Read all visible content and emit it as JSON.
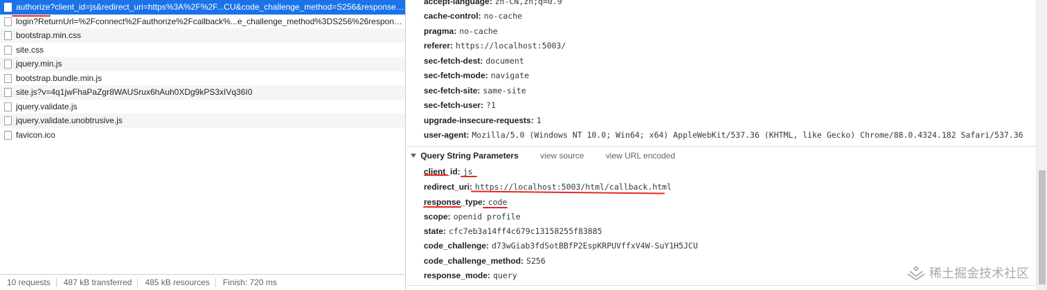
{
  "requests": [
    {
      "name": "authorize?client_id=js&redirect_uri=https%3A%2F%2F...CU&code_challenge_method=S256&response_m..."
    },
    {
      "name": "login?ReturnUrl=%2Fconnect%2Fauthorize%2Fcallback%...e_challenge_method%3DS256%26response_m..."
    },
    {
      "name": "bootstrap.min.css"
    },
    {
      "name": "site.css"
    },
    {
      "name": "jquery.min.js"
    },
    {
      "name": "bootstrap.bundle.min.js"
    },
    {
      "name": "site.js?v=4q1jwFhaPaZgr8WAUSrux6hAuh0XDg9kPS3xIVq36I0"
    },
    {
      "name": "jquery.validate.js"
    },
    {
      "name": "jquery.validate.unobtrusive.js"
    },
    {
      "name": "favicon.ico"
    }
  ],
  "status_bar": {
    "requests": "10 requests",
    "transferred": "487 kB transferred",
    "resources": "485 kB resources",
    "finish": "Finish: 720 ms"
  },
  "request_headers": [
    {
      "name": "accept-language:",
      "value": "zh-CN,zh;q=0.9"
    },
    {
      "name": "cache-control:",
      "value": "no-cache"
    },
    {
      "name": "pragma:",
      "value": "no-cache"
    },
    {
      "name": "referer:",
      "value": "https://localhost:5003/"
    },
    {
      "name": "sec-fetch-dest:",
      "value": "document"
    },
    {
      "name": "sec-fetch-mode:",
      "value": "navigate"
    },
    {
      "name": "sec-fetch-site:",
      "value": "same-site"
    },
    {
      "name": "sec-fetch-user:",
      "value": "?1"
    },
    {
      "name": "upgrade-insecure-requests:",
      "value": "1"
    },
    {
      "name": "user-agent:",
      "value": "Mozilla/5.0 (Windows NT 10.0; Win64; x64) AppleWebKit/537.36 (KHTML, like Gecko) Chrome/88.0.4324.182 Safari/537.36"
    }
  ],
  "query_section": {
    "title": "Query String Parameters",
    "view_source": "view source",
    "view_url_encoded": "view URL encoded"
  },
  "query_params": [
    {
      "name": "client_id:",
      "value": "js"
    },
    {
      "name": "redirect_uri:",
      "value": "https://localhost:5003/html/callback.html"
    },
    {
      "name": "response_type:",
      "value": "code"
    },
    {
      "name": "scope:",
      "value": "openid profile"
    },
    {
      "name": "state:",
      "value": "cfc7eb3a14ff4c679c13158255f83885"
    },
    {
      "name": "code_challenge:",
      "value": "d73wGiab3fdSotBBfP2EspKRPUVffxV4W-SuY1H5JCU"
    },
    {
      "name": "code_challenge_method:",
      "value": "S256"
    },
    {
      "name": "response_mode:",
      "value": "query"
    }
  ],
  "watermark": {
    "text": "稀土掘金技术社区"
  },
  "colors": {
    "selection": "#1a73e8",
    "annotation": "#e8261f"
  }
}
